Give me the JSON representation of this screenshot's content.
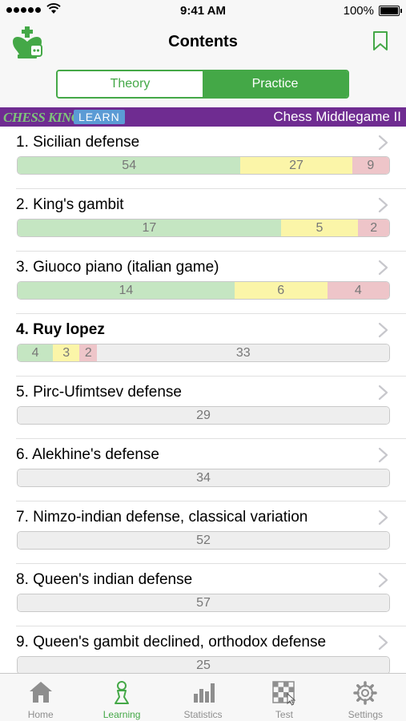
{
  "status": {
    "time": "9:41 AM",
    "battery": "100%"
  },
  "nav": {
    "title": "Contents"
  },
  "segments": {
    "theory": "Theory",
    "practice": "Practice",
    "selected": "practice"
  },
  "banner": {
    "brand": "CHESS KING",
    "badge": "LEARN",
    "course": "Chess Middlegame II"
  },
  "colors": {
    "accent": "#44a847",
    "banner": "#6f2c91",
    "solved": "#c5e6c2",
    "partial": "#fbf5a8",
    "failed": "#eec5c9",
    "unsolved": "#eeeeee"
  },
  "items": [
    {
      "title": "1. Sicilian defense",
      "bold": false,
      "stats": [
        {
          "type": "g",
          "value": "54"
        },
        {
          "type": "y",
          "value": "27"
        },
        {
          "type": "r",
          "value": "9"
        }
      ]
    },
    {
      "title": "2. King's gambit",
      "bold": false,
      "stats": [
        {
          "type": "g",
          "value": "17"
        },
        {
          "type": "y",
          "value": "5"
        },
        {
          "type": "r",
          "value": "2"
        }
      ]
    },
    {
      "title": "3. Giuoco piano (italian game)",
      "bold": false,
      "stats": [
        {
          "type": "g",
          "value": "14"
        },
        {
          "type": "y",
          "value": "6"
        },
        {
          "type": "r",
          "value": "4"
        }
      ]
    },
    {
      "title": "4. Ruy lopez",
      "bold": true,
      "stats": [
        {
          "type": "g",
          "value": "4"
        },
        {
          "type": "y",
          "value": "3"
        },
        {
          "type": "r",
          "value": "2"
        },
        {
          "type": "n",
          "value": "33"
        }
      ]
    },
    {
      "title": "5. Pirc-Ufimtsev defense",
      "bold": false,
      "stats": [
        {
          "type": "n",
          "value": "29"
        }
      ]
    },
    {
      "title": "6. Alekhine's defense",
      "bold": false,
      "stats": [
        {
          "type": "n",
          "value": "34"
        }
      ]
    },
    {
      "title": "7. Nimzo-indian defense, classical variation",
      "bold": false,
      "stats": [
        {
          "type": "n",
          "value": "52"
        }
      ]
    },
    {
      "title": "8. Queen's indian defense",
      "bold": false,
      "stats": [
        {
          "type": "n",
          "value": "57"
        }
      ]
    },
    {
      "title": "9. Queen's gambit declined, orthodox defense",
      "bold": false,
      "stats": [
        {
          "type": "n",
          "value": "25"
        }
      ]
    }
  ],
  "tabs": [
    {
      "label": "Home",
      "icon": "home-icon",
      "active": false
    },
    {
      "label": "Learning",
      "icon": "pawn-icon",
      "active": true
    },
    {
      "label": "Statistics",
      "icon": "bar-chart-icon",
      "active": false
    },
    {
      "label": "Test",
      "icon": "chessboard-icon",
      "active": false
    },
    {
      "label": "Settings",
      "icon": "gear-icon",
      "active": false
    }
  ]
}
